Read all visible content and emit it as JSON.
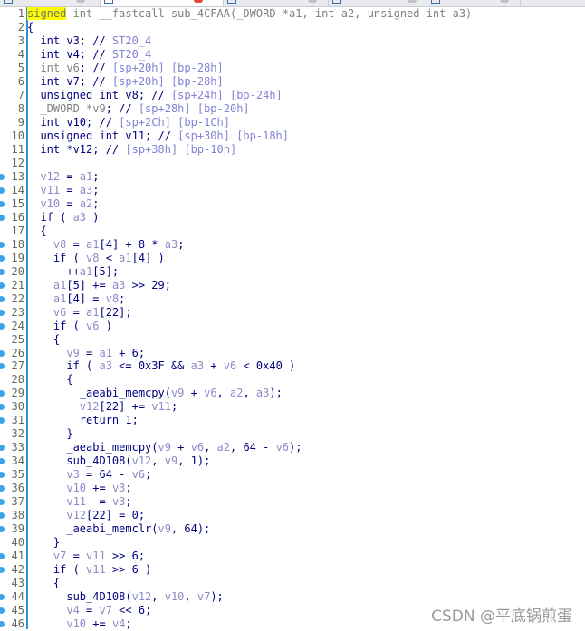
{
  "watermark": "CSDN @平底锅煎蛋",
  "colors": {
    "keyword": "#000080",
    "variable": "#8a8ac8",
    "comment": "#8282d6",
    "highlight": "#ffff00",
    "breakpoint": "#3ba3ea"
  },
  "lines": [
    {
      "n": "1",
      "bp": false,
      "segs": [
        [
          "signed",
          "hl"
        ],
        [
          " int __fastcall sub_4CFAA(_DWORD *a1, int a2, unsigned int a3)",
          "g"
        ]
      ]
    },
    {
      "n": "2",
      "bp": false,
      "segs": [
        [
          "{",
          "k"
        ]
      ]
    },
    {
      "n": "3",
      "bp": false,
      "segs": [
        [
          "  int v3; // ",
          "k"
        ],
        [
          "ST20_4",
          "c"
        ]
      ]
    },
    {
      "n": "4",
      "bp": false,
      "segs": [
        [
          "  int v4; // ",
          "k"
        ],
        [
          "ST20_4",
          "c"
        ]
      ]
    },
    {
      "n": "5",
      "bp": false,
      "segs": [
        [
          "  int v6",
          "g"
        ],
        [
          "; // ",
          "k"
        ],
        [
          "[sp+20h] [bp-28h]",
          "c"
        ]
      ]
    },
    {
      "n": "6",
      "bp": false,
      "segs": [
        [
          "  int v7; // ",
          "k"
        ],
        [
          "[sp+20h] [bp-28h]",
          "c"
        ]
      ]
    },
    {
      "n": "7",
      "bp": false,
      "segs": [
        [
          "  unsigned int v8; // ",
          "k"
        ],
        [
          "[sp+24h] [bp-24h]",
          "c"
        ]
      ]
    },
    {
      "n": "8",
      "bp": false,
      "segs": [
        [
          "  _DWORD *v9",
          "g"
        ],
        [
          "; // ",
          "k"
        ],
        [
          "[sp+28h] [bp-20h]",
          "c"
        ]
      ]
    },
    {
      "n": "9",
      "bp": false,
      "segs": [
        [
          "  int v10; // ",
          "k"
        ],
        [
          "[sp+2Ch] [bp-1Ch]",
          "c"
        ]
      ]
    },
    {
      "n": "10",
      "bp": false,
      "segs": [
        [
          "  unsigned int v11; // ",
          "k"
        ],
        [
          "[sp+30h] [bp-18h]",
          "c"
        ]
      ]
    },
    {
      "n": "11",
      "bp": false,
      "segs": [
        [
          "  int *v12; // ",
          "k"
        ],
        [
          "[sp+38h] [bp-10h]",
          "c"
        ]
      ]
    },
    {
      "n": "12",
      "bp": false,
      "segs": []
    },
    {
      "n": "13",
      "bp": true,
      "segs": [
        [
          "  ",
          "k"
        ],
        [
          "v12",
          "v"
        ],
        [
          " = ",
          "k"
        ],
        [
          "a1",
          "v"
        ],
        [
          ";",
          "k"
        ]
      ]
    },
    {
      "n": "14",
      "bp": true,
      "segs": [
        [
          "  ",
          "k"
        ],
        [
          "v11",
          "v"
        ],
        [
          " = ",
          "k"
        ],
        [
          "a3",
          "v"
        ],
        [
          ";",
          "k"
        ]
      ]
    },
    {
      "n": "15",
      "bp": true,
      "segs": [
        [
          "  ",
          "k"
        ],
        [
          "v10",
          "v"
        ],
        [
          " = ",
          "k"
        ],
        [
          "a2",
          "v"
        ],
        [
          ";",
          "k"
        ]
      ]
    },
    {
      "n": "16",
      "bp": true,
      "segs": [
        [
          "  if ( ",
          "k"
        ],
        [
          "a3",
          "v"
        ],
        [
          " )",
          "k"
        ]
      ]
    },
    {
      "n": "17",
      "bp": false,
      "segs": [
        [
          "  {",
          "k"
        ]
      ]
    },
    {
      "n": "18",
      "bp": true,
      "segs": [
        [
          "    ",
          "k"
        ],
        [
          "v8",
          "v"
        ],
        [
          " = ",
          "k"
        ],
        [
          "a1",
          "v"
        ],
        [
          "[4] + 8 * ",
          "k"
        ],
        [
          "a3",
          "v"
        ],
        [
          ";",
          "k"
        ]
      ]
    },
    {
      "n": "19",
      "bp": true,
      "segs": [
        [
          "    if ( ",
          "k"
        ],
        [
          "v8",
          "v"
        ],
        [
          " < ",
          "k"
        ],
        [
          "a1",
          "v"
        ],
        [
          "[4] )",
          "k"
        ]
      ]
    },
    {
      "n": "20",
      "bp": true,
      "segs": [
        [
          "      ++",
          "k"
        ],
        [
          "a1",
          "v"
        ],
        [
          "[5];",
          "k"
        ]
      ]
    },
    {
      "n": "21",
      "bp": true,
      "segs": [
        [
          "    ",
          "k"
        ],
        [
          "a1",
          "v"
        ],
        [
          "[5] += ",
          "k"
        ],
        [
          "a3",
          "v"
        ],
        [
          " >> 29;",
          "k"
        ]
      ]
    },
    {
      "n": "22",
      "bp": true,
      "segs": [
        [
          "    ",
          "k"
        ],
        [
          "a1",
          "v"
        ],
        [
          "[4] = ",
          "k"
        ],
        [
          "v8",
          "v"
        ],
        [
          ";",
          "k"
        ]
      ]
    },
    {
      "n": "23",
      "bp": true,
      "segs": [
        [
          "    ",
          "k"
        ],
        [
          "v6",
          "v"
        ],
        [
          " = ",
          "k"
        ],
        [
          "a1",
          "v"
        ],
        [
          "[22];",
          "k"
        ]
      ]
    },
    {
      "n": "24",
      "bp": true,
      "segs": [
        [
          "    if ( ",
          "k"
        ],
        [
          "v6",
          "v"
        ],
        [
          " )",
          "k"
        ]
      ]
    },
    {
      "n": "25",
      "bp": false,
      "segs": [
        [
          "    {",
          "k"
        ]
      ]
    },
    {
      "n": "26",
      "bp": true,
      "segs": [
        [
          "      ",
          "k"
        ],
        [
          "v9",
          "v"
        ],
        [
          " = ",
          "k"
        ],
        [
          "a1",
          "v"
        ],
        [
          " + 6;",
          "k"
        ]
      ]
    },
    {
      "n": "27",
      "bp": true,
      "segs": [
        [
          "      if ( ",
          "k"
        ],
        [
          "a3",
          "v"
        ],
        [
          " <= 0x3F && ",
          "k"
        ],
        [
          "a3",
          "v"
        ],
        [
          " + ",
          "k"
        ],
        [
          "v6",
          "v"
        ],
        [
          " < 0x40 )",
          "k"
        ]
      ]
    },
    {
      "n": "28",
      "bp": false,
      "segs": [
        [
          "      {",
          "k"
        ]
      ]
    },
    {
      "n": "29",
      "bp": true,
      "segs": [
        [
          "        _aeabi_memcpy(",
          "k"
        ],
        [
          "v9",
          "v"
        ],
        [
          " + ",
          "k"
        ],
        [
          "v6",
          "v"
        ],
        [
          ", ",
          "k"
        ],
        [
          "a2",
          "v"
        ],
        [
          ", ",
          "k"
        ],
        [
          "a3",
          "v"
        ],
        [
          ");",
          "k"
        ]
      ]
    },
    {
      "n": "30",
      "bp": true,
      "segs": [
        [
          "        ",
          "k"
        ],
        [
          "v12",
          "v"
        ],
        [
          "[22] += ",
          "k"
        ],
        [
          "v11",
          "v"
        ],
        [
          ";",
          "k"
        ]
      ]
    },
    {
      "n": "31",
      "bp": true,
      "segs": [
        [
          "        return 1;",
          "k"
        ]
      ]
    },
    {
      "n": "32",
      "bp": false,
      "segs": [
        [
          "      }",
          "k"
        ]
      ]
    },
    {
      "n": "33",
      "bp": true,
      "segs": [
        [
          "      _aeabi_memcpy(",
          "k"
        ],
        [
          "v9",
          "v"
        ],
        [
          " + ",
          "k"
        ],
        [
          "v6",
          "v"
        ],
        [
          ", ",
          "k"
        ],
        [
          "a2",
          "v"
        ],
        [
          ", 64 - ",
          "k"
        ],
        [
          "v6",
          "v"
        ],
        [
          ");",
          "k"
        ]
      ]
    },
    {
      "n": "34",
      "bp": true,
      "segs": [
        [
          "      sub_4D108(",
          "k"
        ],
        [
          "v12",
          "v"
        ],
        [
          ", ",
          "k"
        ],
        [
          "v9",
          "v"
        ],
        [
          ", 1);",
          "k"
        ]
      ]
    },
    {
      "n": "35",
      "bp": true,
      "segs": [
        [
          "      ",
          "k"
        ],
        [
          "v3",
          "v"
        ],
        [
          " = 64 - ",
          "k"
        ],
        [
          "v6",
          "v"
        ],
        [
          ";",
          "k"
        ]
      ]
    },
    {
      "n": "36",
      "bp": true,
      "segs": [
        [
          "      ",
          "k"
        ],
        [
          "v10",
          "v"
        ],
        [
          " += ",
          "k"
        ],
        [
          "v3",
          "v"
        ],
        [
          ";",
          "k"
        ]
      ]
    },
    {
      "n": "37",
      "bp": true,
      "segs": [
        [
          "      ",
          "k"
        ],
        [
          "v11",
          "v"
        ],
        [
          " -= ",
          "k"
        ],
        [
          "v3",
          "v"
        ],
        [
          ";",
          "k"
        ]
      ]
    },
    {
      "n": "38",
      "bp": true,
      "segs": [
        [
          "      ",
          "k"
        ],
        [
          "v12",
          "v"
        ],
        [
          "[22] = 0;",
          "k"
        ]
      ]
    },
    {
      "n": "39",
      "bp": true,
      "segs": [
        [
          "      _aeabi_memclr(",
          "k"
        ],
        [
          "v9",
          "v"
        ],
        [
          ", 64);",
          "k"
        ]
      ]
    },
    {
      "n": "40",
      "bp": false,
      "segs": [
        [
          "    }",
          "k"
        ]
      ]
    },
    {
      "n": "41",
      "bp": true,
      "segs": [
        [
          "    ",
          "k"
        ],
        [
          "v7",
          "v"
        ],
        [
          " = ",
          "k"
        ],
        [
          "v11",
          "v"
        ],
        [
          " >> 6;",
          "k"
        ]
      ]
    },
    {
      "n": "42",
      "bp": true,
      "segs": [
        [
          "    if ( ",
          "k"
        ],
        [
          "v11",
          "v"
        ],
        [
          " >> 6 )",
          "k"
        ]
      ]
    },
    {
      "n": "43",
      "bp": false,
      "segs": [
        [
          "    {",
          "k"
        ]
      ]
    },
    {
      "n": "44",
      "bp": true,
      "segs": [
        [
          "      sub_4D108(",
          "k"
        ],
        [
          "v12",
          "v"
        ],
        [
          ", ",
          "k"
        ],
        [
          "v10",
          "v"
        ],
        [
          ", ",
          "k"
        ],
        [
          "v7",
          "v"
        ],
        [
          ");",
          "k"
        ]
      ]
    },
    {
      "n": "45",
      "bp": true,
      "segs": [
        [
          "      ",
          "k"
        ],
        [
          "v4",
          "v"
        ],
        [
          " = ",
          "k"
        ],
        [
          "v7",
          "v"
        ],
        [
          " << 6;",
          "k"
        ]
      ]
    },
    {
      "n": "46",
      "bp": true,
      "segs": [
        [
          "      ",
          "k"
        ],
        [
          "v10",
          "v"
        ],
        [
          " += ",
          "k"
        ],
        [
          "v4",
          "v"
        ],
        [
          ";",
          "k"
        ]
      ]
    }
  ]
}
